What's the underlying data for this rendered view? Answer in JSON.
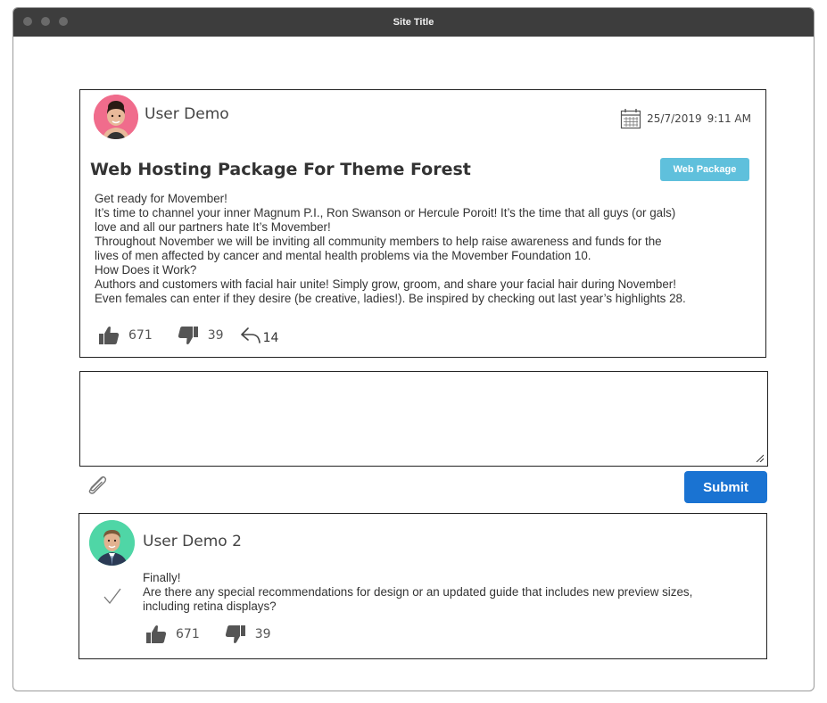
{
  "window": {
    "title": "Site Title"
  },
  "post": {
    "author": "User Demo",
    "date": "25/7/2019",
    "time": "9:11 AM",
    "title": "Web Hosting Package For Theme Forest",
    "tag": "Web Package",
    "body": [
      "Get ready for Movember!",
      "It’s time to channel your inner Magnum P.I., Ron Swanson or Hercule Poroit! It’s the time that all guys (or gals)",
      "love and all our partners hate It’s Movember!",
      "Throughout November we will be inviting all community members to help raise awareness and funds for the",
      "lives of men affected by cancer and mental health problems via the Movember Foundation 10.",
      "How Does it Work?",
      "Authors and customers with facial hair unite! Simply grow, groom, and share your facial hair during November!",
      "Even females can enter if they desire (be creative, ladies!). Be inspired by checking out last year’s highlights 28."
    ],
    "likes": "671",
    "dislikes": "39",
    "replies": "14"
  },
  "reply_box": {
    "value": "",
    "submit_label": "Submit"
  },
  "comment": {
    "author": "User Demo 2",
    "body": [
      "Finally!",
      "Are there any special recommendations for design or an updated guide that includes new preview sizes,",
      "including retina displays?"
    ],
    "likes": "671",
    "dislikes": "39"
  },
  "icons": {
    "calendar": "calendar-icon",
    "like": "thumbs-up-icon",
    "dislike": "thumbs-down-icon",
    "reply": "reply-icon",
    "attach": "paperclip-icon",
    "accepted": "checkmark-icon",
    "resize": "resize-handle-icon"
  },
  "colors": {
    "tag": "#5fc0dc",
    "submit": "#1a73d2",
    "avatar1": "#f06c8c",
    "avatar2": "#4fd6a6",
    "titlebar": "#3d3d3d"
  }
}
